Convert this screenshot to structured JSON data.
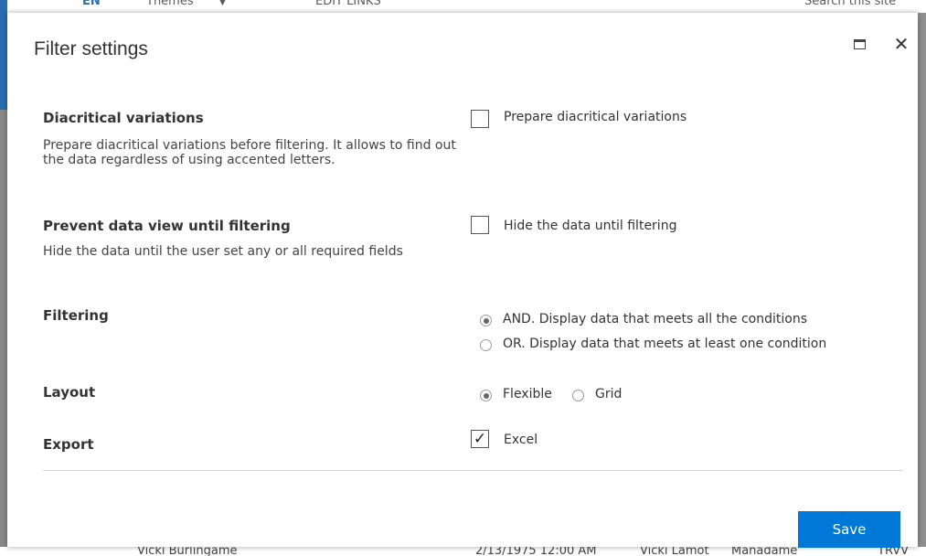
{
  "background": {
    "top_bar": {
      "language": "EN",
      "themes": "Themes",
      "themes_caret": "▼",
      "edit_links": "EDIT LINKS",
      "search": "Search this site"
    },
    "bottom_bar": {
      "left": "Vicki Burlingame",
      "mid": "2/13/1975 12:00 AM",
      "right": "Vicki Lamot",
      "right2": "Manadame",
      "far_right": "TRVV"
    }
  },
  "dialog": {
    "title": "Filter settings",
    "maximize_icon": "maximize-icon",
    "close_glyph": "✕",
    "settings": {
      "diacritical": {
        "title": "Diacritical variations",
        "description": "Prepare diacritical variations before filtering. It allows to find out the data regardless of using accented letters.",
        "checkbox_label": "Prepare diacritical variations",
        "checked": false
      },
      "prevent_view": {
        "title": "Prevent data view until filtering",
        "description": "Hide the data until the user set any or all required fields",
        "checkbox_label": "Hide the data until filtering",
        "checked": false
      },
      "filtering": {
        "title": "Filtering",
        "options": [
          {
            "label": "AND. Display data that meets all the conditions",
            "selected": true
          },
          {
            "label": "OR. Display data that meets at least one condition",
            "selected": false
          }
        ]
      },
      "layout": {
        "title": "Layout",
        "options": [
          {
            "label": "Flexible",
            "selected": true
          },
          {
            "label": "Grid",
            "selected": false
          }
        ]
      },
      "export": {
        "title": "Export",
        "checkbox_label": "Excel",
        "checked": true,
        "check_glyph": "✓"
      }
    },
    "save_label": "Save"
  },
  "colors": {
    "accent": "#0078d7",
    "overlay": "#7f7f7f"
  }
}
